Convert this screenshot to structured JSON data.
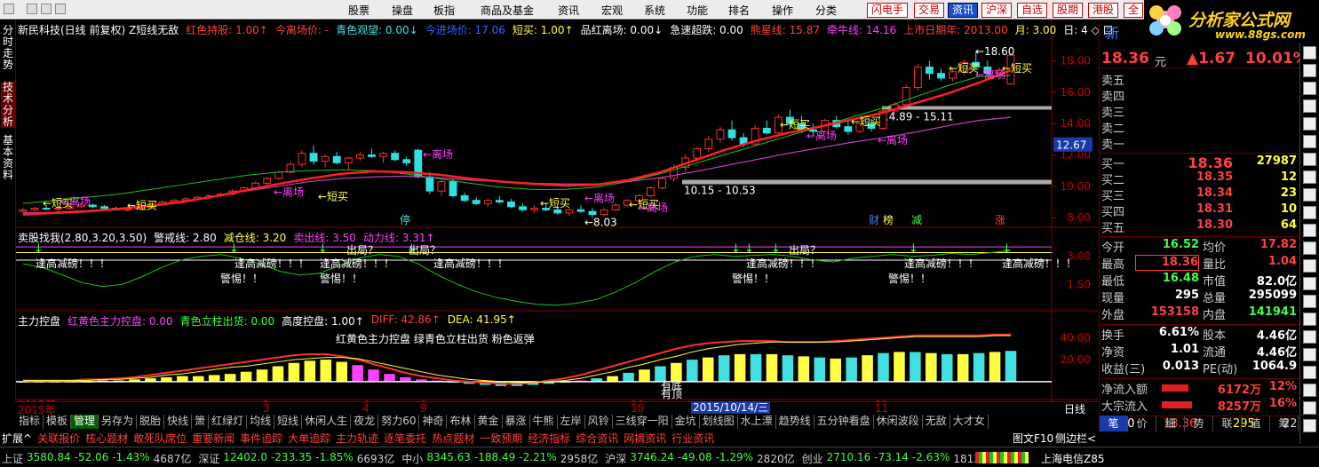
{
  "menu": {
    "items": [
      "股票",
      "操盘",
      "板指",
      "商品及基金",
      "资讯",
      "宏观",
      "系统",
      "功能",
      "排名",
      "操作",
      "分类"
    ],
    "quick_tabs": [
      "闪电手",
      "交易",
      "资讯",
      "沪深",
      "自选",
      "股期",
      "港股",
      "全"
    ]
  },
  "logo": {
    "text": "分析家公式网",
    "sub": "www.88gs.com"
  },
  "left_tabs": [
    "分时走势",
    "技术分析",
    "基本资料"
  ],
  "main_panel": {
    "labels": [
      {
        "t": "新民科技(日线 前复权) Z短线无敌",
        "c": "#fff"
      },
      {
        "t": "红色持股: 1.00↑",
        "c": "#ff4040"
      },
      {
        "t": "今离场价: -",
        "c": "#ff4040"
      },
      {
        "t": "青色观望: 0.00↓",
        "c": "#40e0e0"
      },
      {
        "t": "今进场价: 17.06",
        "c": "#4060ff"
      },
      {
        "t": "短买: 1.00↑",
        "c": "#ffff40"
      },
      {
        "t": "品红离场: 0.00↓",
        "c": "#fff"
      },
      {
        "t": "急速超跌: 0.00",
        "c": "#fff"
      },
      {
        "t": "熊星线: 15.87",
        "c": "#ff4040"
      },
      {
        "t": "牵牛线: 14.16",
        "c": "#ff40ff"
      },
      {
        "t": "上市日期年: 2013.00",
        "c": "#ff4040"
      },
      {
        "t": "月: 3.00",
        "c": "#ffff40"
      },
      {
        "t": "日: 4 ◇ 口",
        "c": "#fff"
      }
    ],
    "y_ticks": [
      "18.00",
      "16.00",
      "14.00",
      "12.00",
      "10.00",
      "8.00"
    ],
    "current_price": "12.67",
    "annotations": {
      "high": "18.60",
      "low": "8.03",
      "box1": "14.89 - 15.11",
      "box2": "10.15 - 10.53"
    },
    "text_marks": [
      "短买",
      "离场",
      "短买",
      "离场",
      "短买",
      "离场",
      "短买",
      "离场",
      "短买",
      "离场",
      "短买",
      "离场",
      "短买",
      "离场",
      "短买",
      "离场",
      "短买"
    ],
    "event_marks": [
      {
        "t": "停",
        "c": "#40e0e0"
      },
      {
        "t": "财",
        "c": "#4080ff"
      },
      {
        "t": "榜",
        "c": "#ffff40"
      },
      {
        "t": "减",
        "c": "#40ff40"
      },
      {
        "t": "涨",
        "c": "#ff4040"
      }
    ]
  },
  "sub1": {
    "labels": [
      {
        "t": "卖股找我(2.80,3.20,3.50)",
        "c": "#fff"
      },
      {
        "t": "警戒线: 2.80",
        "c": "#fff"
      },
      {
        "t": "减仓线: 3.20",
        "c": "#ffff40"
      },
      {
        "t": "卖出线: 3.50",
        "c": "#ff40ff"
      },
      {
        "t": "动力线: 3.31↑",
        "c": "#ff40ff"
      }
    ],
    "y_ticks": [
      "3.00",
      "1.50"
    ],
    "notes": {
      "high": "逢高减磅！！！",
      "warn": "警惕！！",
      "out": "出局？"
    }
  },
  "sub2": {
    "labels": [
      {
        "t": "主力控盘",
        "c": "#fff"
      },
      {
        "t": "红黄色主力控盘: 0.00",
        "c": "#ff40ff"
      },
      {
        "t": "青色立柱出货: 0.00",
        "c": "#40ff40"
      },
      {
        "t": "高度控盘: 1.00↑",
        "c": "#fff"
      },
      {
        "t": "DIFF: 42.86↑",
        "c": "#ff4040"
      },
      {
        "t": "DEA: 41.95↑",
        "c": "#ffff40"
      }
    ],
    "center_note": "红黄色主力控盘 绿青色立柱出货 粉色返弹",
    "y_ticks": [
      "40.00",
      "20.00"
    ],
    "marks": [
      "有底",
      "有顶"
    ]
  },
  "x_axis": {
    "labels": [
      "2015年",
      "3",
      "4",
      "9",
      "10",
      "11"
    ],
    "date_box": "2015/10/14/三",
    "period": "日线"
  },
  "chart_data": {
    "type": "candlestick",
    "ylim": [
      7.5,
      19.5
    ],
    "ohlc": [
      [
        8.4,
        8.6,
        8.3,
        8.5
      ],
      [
        8.5,
        8.7,
        8.4,
        8.6
      ],
      [
        8.6,
        8.8,
        8.5,
        8.55
      ],
      [
        8.55,
        8.7,
        8.4,
        8.6
      ],
      [
        8.6,
        8.75,
        8.5,
        8.7
      ],
      [
        8.7,
        8.9,
        8.6,
        8.8
      ],
      [
        8.8,
        8.9,
        8.6,
        8.7
      ],
      [
        8.7,
        8.8,
        8.5,
        8.6
      ],
      [
        8.6,
        8.7,
        8.45,
        8.5
      ],
      [
        8.5,
        8.6,
        8.4,
        8.55
      ],
      [
        8.55,
        8.7,
        8.5,
        8.65
      ],
      [
        8.65,
        8.9,
        8.6,
        8.85
      ],
      [
        8.85,
        9.1,
        8.8,
        9.0
      ],
      [
        9.0,
        9.2,
        8.9,
        9.1
      ],
      [
        9.1,
        9.3,
        9.0,
        9.2
      ],
      [
        9.2,
        9.4,
        9.1,
        9.3
      ],
      [
        9.3,
        9.5,
        9.2,
        9.4
      ],
      [
        9.4,
        9.6,
        9.3,
        9.5
      ],
      [
        9.5,
        9.8,
        9.4,
        9.7
      ],
      [
        9.7,
        10.0,
        9.6,
        9.9
      ],
      [
        9.9,
        10.3,
        9.8,
        10.2
      ],
      [
        10.2,
        10.6,
        10.1,
        10.5
      ],
      [
        10.5,
        11.0,
        10.4,
        10.9
      ],
      [
        10.9,
        11.6,
        10.8,
        11.4
      ],
      [
        11.4,
        12.3,
        11.2,
        12.1
      ],
      [
        12.1,
        12.6,
        11.4,
        11.6
      ],
      [
        11.6,
        12.0,
        11.2,
        11.9
      ],
      [
        11.9,
        12.2,
        11.4,
        11.5
      ],
      [
        11.5,
        11.9,
        11.0,
        11.8
      ],
      [
        11.8,
        12.2,
        11.6,
        12.0
      ],
      [
        12.0,
        12.4,
        11.8,
        11.9
      ],
      [
        11.9,
        12.2,
        11.5,
        12.1
      ],
      [
        12.1,
        12.3,
        11.6,
        11.7
      ],
      [
        11.7,
        11.9,
        11.3,
        11.5
      ],
      [
        12.3,
        12.4,
        10.5,
        10.6
      ],
      [
        10.6,
        10.9,
        9.5,
        9.7
      ],
      [
        9.7,
        10.4,
        9.4,
        10.3
      ],
      [
        10.3,
        10.5,
        9.3,
        9.4
      ],
      [
        9.4,
        9.6,
        9.0,
        9.1
      ],
      [
        9.1,
        9.3,
        8.8,
        8.9
      ],
      [
        8.9,
        9.2,
        8.7,
        9.1
      ],
      [
        9.1,
        9.4,
        8.9,
        9.0
      ],
      [
        9.0,
        9.2,
        8.6,
        8.7
      ],
      [
        8.7,
        8.9,
        8.4,
        8.5
      ],
      [
        8.5,
        8.8,
        8.3,
        8.6
      ],
      [
        8.6,
        8.9,
        8.4,
        8.5
      ],
      [
        8.5,
        8.7,
        8.2,
        8.3
      ],
      [
        8.3,
        8.6,
        8.1,
        8.5
      ],
      [
        8.5,
        8.8,
        8.3,
        8.4
      ],
      [
        8.4,
        8.6,
        8.03,
        8.2
      ],
      [
        8.2,
        8.6,
        8.1,
        8.5
      ],
      [
        8.5,
        8.9,
        8.4,
        8.8
      ],
      [
        8.8,
        9.2,
        8.7,
        9.1
      ],
      [
        9.1,
        9.5,
        8.9,
        9.4
      ],
      [
        9.4,
        10.0,
        9.3,
        9.9
      ],
      [
        9.9,
        10.6,
        9.8,
        10.5
      ],
      [
        10.5,
        11.4,
        10.3,
        11.2
      ],
      [
        11.2,
        12.0,
        10.9,
        11.8
      ],
      [
        11.8,
        12.5,
        11.6,
        12.4
      ],
      [
        12.4,
        13.2,
        12.2,
        13.0
      ],
      [
        13.0,
        13.8,
        12.8,
        13.6
      ],
      [
        13.6,
        14.2,
        12.9,
        13.1
      ],
      [
        13.1,
        13.4,
        12.5,
        12.7
      ],
      [
        12.7,
        13.9,
        12.6,
        13.7
      ],
      [
        13.7,
        14.2,
        13.3,
        13.4
      ],
      [
        13.4,
        14.6,
        13.3,
        14.4
      ],
      [
        14.4,
        14.9,
        13.8,
        14.0
      ],
      [
        14.0,
        14.5,
        13.4,
        13.6
      ],
      [
        13.6,
        14.0,
        13.2,
        13.5
      ],
      [
        13.5,
        14.3,
        13.4,
        14.2
      ],
      [
        14.2,
        14.5,
        13.7,
        13.8
      ],
      [
        13.8,
        14.2,
        13.3,
        13.5
      ],
      [
        13.5,
        14.1,
        13.4,
        14.0
      ],
      [
        14.0,
        14.3,
        13.5,
        13.7
      ],
      [
        13.7,
        14.9,
        13.6,
        14.8
      ],
      [
        14.8,
        15.4,
        14.6,
        15.2
      ],
      [
        15.2,
        16.5,
        15.0,
        16.3
      ],
      [
        16.3,
        17.8,
        16.1,
        17.6
      ],
      [
        17.6,
        18.0,
        16.8,
        17.2
      ],
      [
        17.2,
        17.5,
        16.7,
        16.9
      ],
      [
        16.9,
        17.5,
        16.7,
        17.3
      ],
      [
        17.3,
        18.1,
        17.1,
        17.9
      ],
      [
        17.9,
        18.6,
        17.5,
        17.6
      ],
      [
        17.6,
        18.0,
        17.0,
        17.2
      ],
      [
        17.2,
        17.6,
        16.8,
        17.4
      ],
      [
        16.52,
        18.36,
        16.48,
        18.36
      ]
    ],
    "ma_red": [
      8.2,
      8.3,
      8.4,
      8.55,
      8.75,
      9.0,
      9.35,
      9.75,
      10.15,
      10.5,
      10.8,
      10.95,
      10.9,
      10.75,
      10.5,
      10.3,
      10.15,
      10.05,
      10.1,
      10.4,
      10.9,
      11.6,
      12.3,
      12.9,
      13.4,
      13.8,
      14.25,
      14.7,
      15.3,
      15.9,
      16.6,
      17.4
    ],
    "ma_purple": [
      8.3,
      8.35,
      8.45,
      8.6,
      8.8,
      9.05,
      9.35,
      9.7,
      10.0,
      10.3,
      10.5,
      10.6,
      10.65,
      10.55,
      10.4,
      10.3,
      10.2,
      10.15,
      10.15,
      10.3,
      10.55,
      10.9,
      11.3,
      11.7,
      12.1,
      12.45,
      12.8,
      13.1,
      13.45,
      13.85,
      14.2,
      14.4
    ],
    "ma_green": [
      8.9,
      9.1,
      9.3,
      9.5,
      9.8,
      10.1,
      10.4,
      10.7,
      10.9,
      11.0,
      11.05,
      11.0,
      10.8,
      10.5,
      10.2,
      9.95,
      9.8,
      9.8,
      9.95,
      10.3,
      10.8,
      11.4,
      12.0,
      12.6,
      13.2,
      13.8,
      14.4,
      15.0,
      15.7,
      16.4,
      17.0,
      17.06
    ],
    "osc": [
      2.6,
      2.4,
      2.0,
      1.6,
      1.4,
      1.5,
      1.9,
      2.4,
      2.8,
      3.0,
      3.1,
      2.9,
      2.6,
      2.2,
      2.0,
      2.1,
      2.5,
      2.9,
      3.1,
      3.0,
      2.6,
      2.0,
      1.5,
      1.1,
      0.8,
      0.6,
      0.45,
      0.4,
      0.5,
      0.7,
      1.1,
      1.6,
      2.2,
      2.7,
      3.0,
      3.1,
      3.0,
      3.05,
      3.1,
      3.0,
      2.8,
      2.7,
      2.9,
      3.0,
      3.1,
      3.0,
      3.05,
      3.15,
      3.1,
      3.2,
      3.31
    ],
    "macd_bars": [
      0,
      0,
      0,
      0,
      0,
      1,
      1,
      2,
      3,
      4,
      5,
      5,
      6,
      7,
      9,
      11,
      14,
      17,
      19,
      20,
      18,
      15,
      11,
      7,
      4,
      2,
      1,
      -1,
      -2,
      -3,
      -4,
      -4,
      -3,
      -2,
      -1,
      1,
      3,
      5,
      8,
      11,
      14,
      17,
      20,
      22,
      24,
      25,
      25,
      25,
      24,
      23,
      22,
      21,
      22,
      24,
      26,
      27,
      27,
      26,
      25,
      25,
      26,
      27,
      28
    ],
    "diff_line": [
      1,
      1,
      1,
      1,
      2,
      2,
      3,
      4,
      6,
      8,
      10,
      12,
      14,
      16,
      18,
      20,
      22,
      24,
      25,
      25,
      23,
      20,
      16,
      12,
      8,
      5,
      3,
      1,
      0,
      -1,
      -2,
      -2,
      -1,
      1,
      3,
      6,
      10,
      14,
      18,
      22,
      26,
      30,
      33,
      35,
      36,
      37,
      37,
      37,
      36,
      36,
      36,
      37,
      38,
      39,
      40,
      41,
      42,
      42,
      42,
      42,
      42,
      42.9,
      42.86
    ],
    "dea_line": [
      1,
      1,
      1,
      1,
      1,
      2,
      2,
      3,
      4,
      6,
      7,
      9,
      11,
      13,
      14,
      16,
      18,
      20,
      21,
      22,
      22,
      21,
      18,
      15,
      12,
      9,
      6,
      4,
      2,
      1,
      0,
      -1,
      -1,
      0,
      1,
      3,
      6,
      9,
      13,
      16,
      20,
      23,
      27,
      30,
      32,
      34,
      35,
      36,
      36,
      36,
      36,
      36,
      37,
      38,
      39,
      40,
      41,
      41,
      41,
      41,
      41,
      41.9,
      41.95
    ]
  },
  "right_panel": {
    "code": "新",
    "price": "18.36",
    "unit": "元",
    "change": "▲1.67",
    "pct": "10.01%",
    "asks": [
      {
        "l": "卖五"
      },
      {
        "l": "卖四"
      },
      {
        "l": "卖三"
      },
      {
        "l": "卖二"
      },
      {
        "l": "卖一"
      }
    ],
    "bids": [
      {
        "l": "买一",
        "p": "18.36",
        "v": "27987"
      },
      {
        "l": "买二",
        "p": "18.35",
        "v": "12"
      },
      {
        "l": "买三",
        "p": "18.34",
        "v": "23"
      },
      {
        "l": "买四",
        "p": "18.31",
        "v": "10"
      },
      {
        "l": "买五",
        "p": "18.30",
        "v": "64"
      }
    ],
    "stats": [
      {
        "l1": "今开",
        "v1": "16.52",
        "c1": "#40ff40",
        "l2": "均价",
        "v2": "17.82",
        "c2": "#ff4040"
      },
      {
        "l1": "最高",
        "v1": "18.36",
        "c1": "#ff4040",
        "l2": "量比",
        "v2": "1.04",
        "c2": "#ff4040"
      },
      {
        "l1": "最低",
        "v1": "16.48",
        "c1": "#40ff40",
        "l2": "市值",
        "v2": "82.0亿",
        "c2": "#fff"
      },
      {
        "l1": "现量",
        "v1": "295",
        "c1": "#fff",
        "l2": "总量",
        "v2": "295099",
        "c2": "#fff"
      },
      {
        "l1": "外盘",
        "v1": "153158",
        "c1": "#ff4040",
        "l2": "内盘",
        "v2": "141941",
        "c2": "#40ff40"
      }
    ],
    "stats2": [
      {
        "l1": "换手",
        "v1": "6.61%",
        "l2": "股本",
        "v2": "4.46亿"
      },
      {
        "l1": "净资",
        "v1": "1.01",
        "l2": "流通",
        "v2": "4.46亿"
      },
      {
        "l1": "收益(三)",
        "v1": "0.013",
        "l2": "PE(动)",
        "v2": "1064.9"
      }
    ],
    "flows": [
      {
        "l": "净流入额",
        "v": "6172万",
        "p": "12%"
      },
      {
        "l": "大宗流入",
        "v": "8257万",
        "p": "16%"
      }
    ],
    "last_tick": {
      "time": "15:00",
      "price": "18.36",
      "vol": "295",
      "n": "22"
    },
    "bottom_tabs": [
      "笔",
      "价",
      "细",
      "势",
      "联",
      "值",
      "筹"
    ]
  },
  "tabbar": [
    "指标",
    "模板",
    "管理",
    "另存为",
    "脱胎",
    "快线",
    "箫",
    "红绿灯",
    "均线",
    "短线",
    "休闲人生",
    "夜龙",
    "努力60",
    "神奇",
    "布林",
    "黄金",
    "暴涨",
    "牛熊",
    "左岸",
    "风铃",
    "三线穿一阳",
    "金坑",
    "划线图",
    "水上漂",
    "趋势线",
    "五分钟看盘",
    "休闲波段",
    "无敌",
    "大才女"
  ],
  "tabbar2": [
    "扩展^",
    "关联报价",
    "核心题材",
    "敢死队席位",
    "重要新闻",
    "事件追踪",
    "大单追踪",
    "主力轨迹",
    "逐笔委托",
    "热点题材",
    "一致预期",
    "经济指标",
    "综合资讯",
    "网摘资讯",
    "行业资讯"
  ],
  "tabbar2_right": [
    "图文F10",
    "侧边栏<"
  ],
  "status": [
    {
      "name": "上证",
      "v": "3580.84",
      "d": "-52.06",
      "p": "-1.43%",
      "a": "4687亿"
    },
    {
      "name": "深证",
      "v": "12402.0",
      "d": "-233.35",
      "p": "-1.85%",
      "a": "6693亿"
    },
    {
      "name": "中小",
      "v": "8345.63",
      "d": "-188.49",
      "p": "-2.21%",
      "a": "2958亿"
    },
    {
      "name": "沪深",
      "v": "3746.24",
      "d": "-49.08",
      "p": "-1.29%",
      "a": "2820亿"
    },
    {
      "name": "创业",
      "v": "2710.16",
      "d": "-73.14",
      "p": "-2.63%",
      "a": "1813亿"
    }
  ],
  "status_right": "上海电信Z85"
}
